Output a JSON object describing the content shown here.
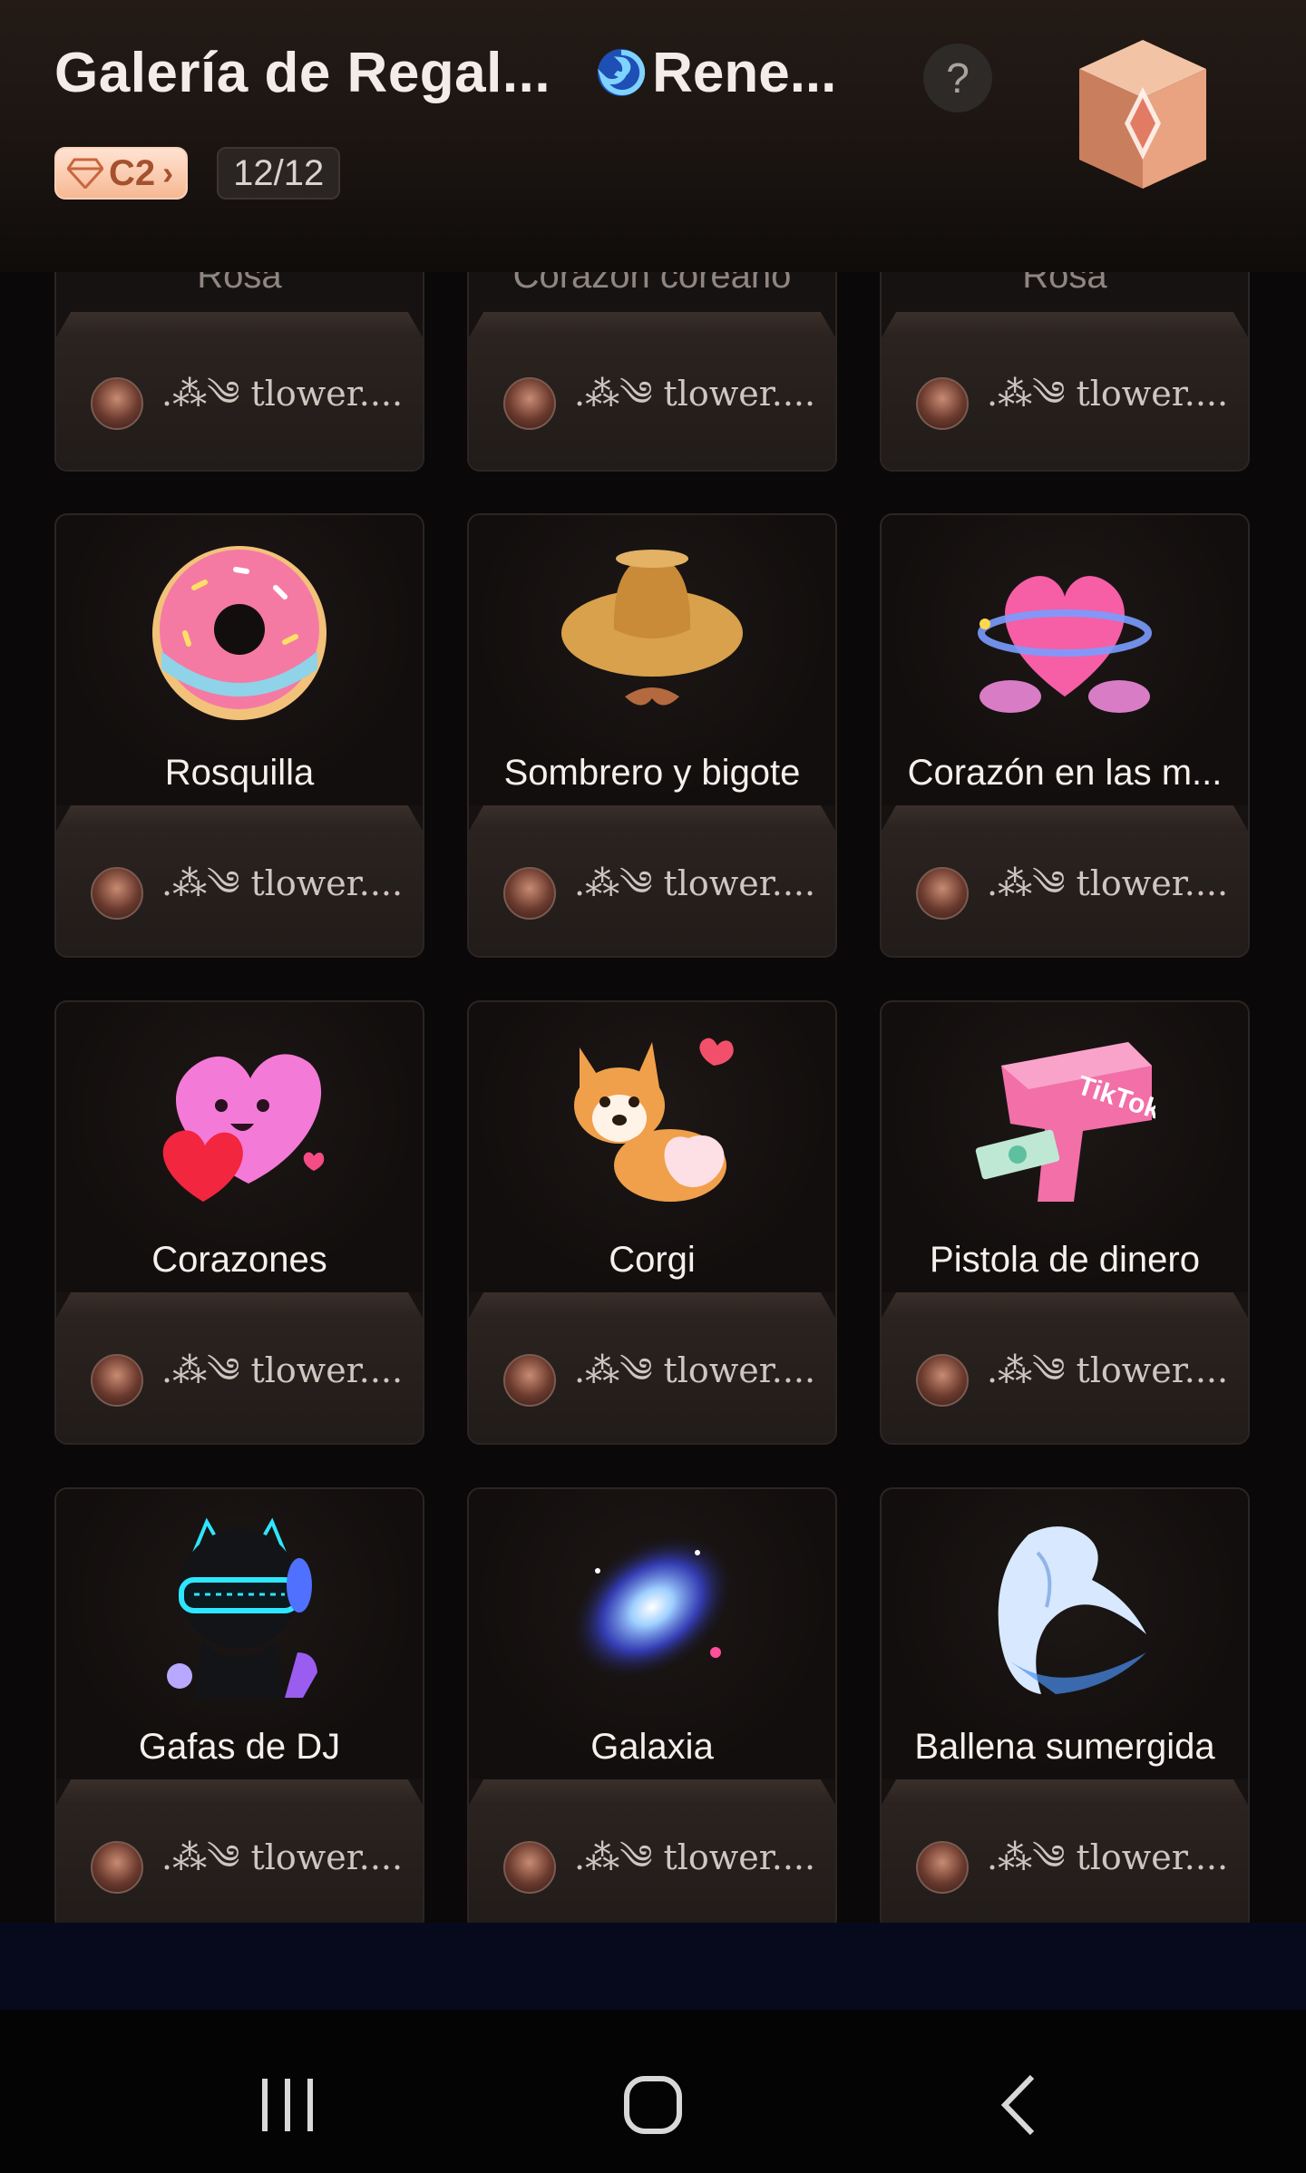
{
  "header": {
    "title": "Galería de Regal...",
    "owner_name": "Rene...",
    "help": "?",
    "level": "C2",
    "progress": "12/12"
  },
  "gifts_top": [
    {
      "name": "Rosa",
      "donor": ".⁂༄ tlower...."
    },
    {
      "name": "Corazón coreano",
      "donor": ".⁂༄ tlower...."
    },
    {
      "name": "Rosa",
      "donor": ".⁂༄ tlower...."
    }
  ],
  "gifts": [
    {
      "name": "Rosquilla",
      "donor": ".⁂༄ tlower....",
      "icon": "donut-icon"
    },
    {
      "name": "Sombrero y bigote",
      "donor": ".⁂༄ tlower....",
      "icon": "hat-mustache-icon"
    },
    {
      "name": "Corazón en las m...",
      "donor": ".⁂༄ tlower....",
      "icon": "heart-in-hands-icon"
    },
    {
      "name": "Corazones",
      "donor": ".⁂༄ tlower....",
      "icon": "hearts-icon"
    },
    {
      "name": "Corgi",
      "donor": ".⁂༄ tlower....",
      "icon": "corgi-icon"
    },
    {
      "name": "Pistola de dinero",
      "donor": ".⁂༄ tlower....",
      "icon": "money-gun-icon"
    },
    {
      "name": "Gafas de DJ",
      "donor": ".⁂༄ tlower....",
      "icon": "dj-glasses-icon"
    },
    {
      "name": "Galaxia",
      "donor": ".⁂༄ tlower....",
      "icon": "galaxy-icon"
    },
    {
      "name": "Ballena sumergida",
      "donor": ".⁂༄ tlower....",
      "icon": "whale-icon"
    }
  ],
  "money_gun_label": "TikTok",
  "colors": {
    "accent_badge": "#f6b893",
    "card_bg": "#161211",
    "nav_bg": "#040404"
  }
}
